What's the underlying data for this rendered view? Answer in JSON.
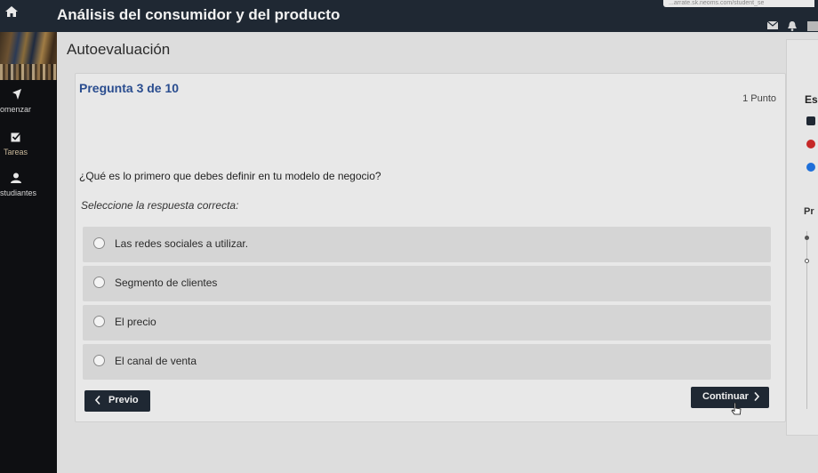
{
  "browser": {
    "url_fragment": "...arrate.sk.neoms.com/student_se"
  },
  "header": {
    "title": "Análisis del consumidor y del producto"
  },
  "sidebar": {
    "items": [
      {
        "label": "omenzar",
        "icon": "arrow-icon"
      },
      {
        "label": "Tareas",
        "icon": "checkbox-icon"
      },
      {
        "label": "studiantes",
        "icon": "user-icon"
      }
    ]
  },
  "main": {
    "title": "Autoevaluación",
    "question": {
      "number_label": "Pregunta 3 de 10",
      "points": "1 Punto",
      "text": "¿Qué es lo primero que debes definir en tu modelo de negocio?",
      "instruction": "Seleccione la respuesta correcta:",
      "options": [
        "Las redes sociales a utilizar.",
        "Segmento de clientes",
        "El precio",
        "El canal de venta"
      ]
    },
    "buttons": {
      "prev": "Previo",
      "next": "Continuar"
    }
  },
  "right_panel": {
    "title": "Es",
    "subtitle": "Pr"
  },
  "colors": {
    "topbar": "#1f2833",
    "accent_blue": "#2a4d8f",
    "error_red": "#c62828",
    "info_blue": "#1e6fd9"
  }
}
